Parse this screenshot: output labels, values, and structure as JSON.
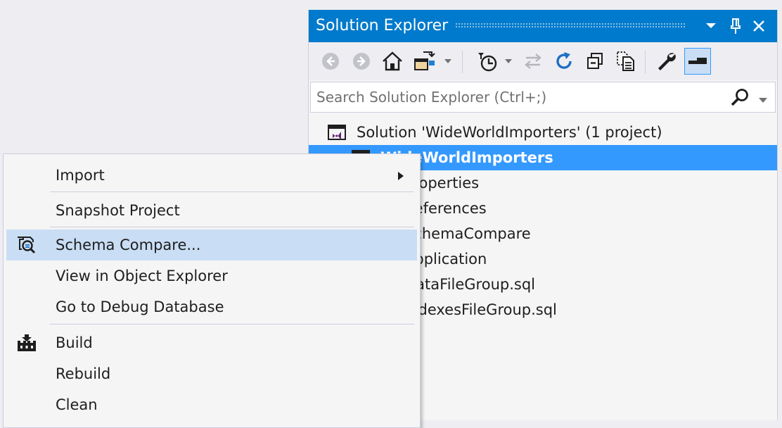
{
  "solution_explorer": {
    "title": "Solution Explorer",
    "search_placeholder": "Search Solution Explorer (Ctrl+;)",
    "tree": [
      {
        "label": "Solution 'WideWorldImporters' (1 project)",
        "icon": "solution-icon",
        "selected": false
      },
      {
        "label": "WideWorldImporters",
        "icon": "project-icon",
        "selected": true
      },
      {
        "label": "Properties",
        "icon": "properties-icon",
        "selected": false
      },
      {
        "label": "References",
        "icon": "references-icon",
        "selected": false
      },
      {
        "label": "SchemaCompare",
        "icon": "folder-icon",
        "selected": false
      },
      {
        "label": "Application",
        "icon": "folder-icon",
        "selected": false
      },
      {
        "label": "DataFileGroup.sql",
        "icon": "sql-file-icon",
        "selected": false
      },
      {
        "label": "IndexesFileGroup.sql",
        "icon": "sql-file-icon",
        "selected": false
      }
    ]
  },
  "context_menu": {
    "items": [
      {
        "label": "Import",
        "icon": "",
        "submenu": true,
        "hover": false
      },
      {
        "label": "Snapshot Project",
        "icon": "",
        "submenu": false,
        "hover": false
      },
      {
        "label": "Schema Compare...",
        "icon": "schema-compare-icon",
        "submenu": false,
        "hover": true
      },
      {
        "label": "View in Object Explorer",
        "icon": "",
        "submenu": false,
        "hover": false
      },
      {
        "label": "Go to Debug Database",
        "icon": "",
        "submenu": false,
        "hover": false
      },
      {
        "label": "Build",
        "icon": "build-icon",
        "submenu": false,
        "hover": false
      },
      {
        "label": "Rebuild",
        "icon": "",
        "submenu": false,
        "hover": false
      },
      {
        "label": "Clean",
        "icon": "",
        "submenu": false,
        "hover": false
      }
    ]
  },
  "colors": {
    "accent": "#007acc",
    "selection": "#3399ff",
    "menu_hover": "#c9def5",
    "background": "#eeeef2"
  }
}
